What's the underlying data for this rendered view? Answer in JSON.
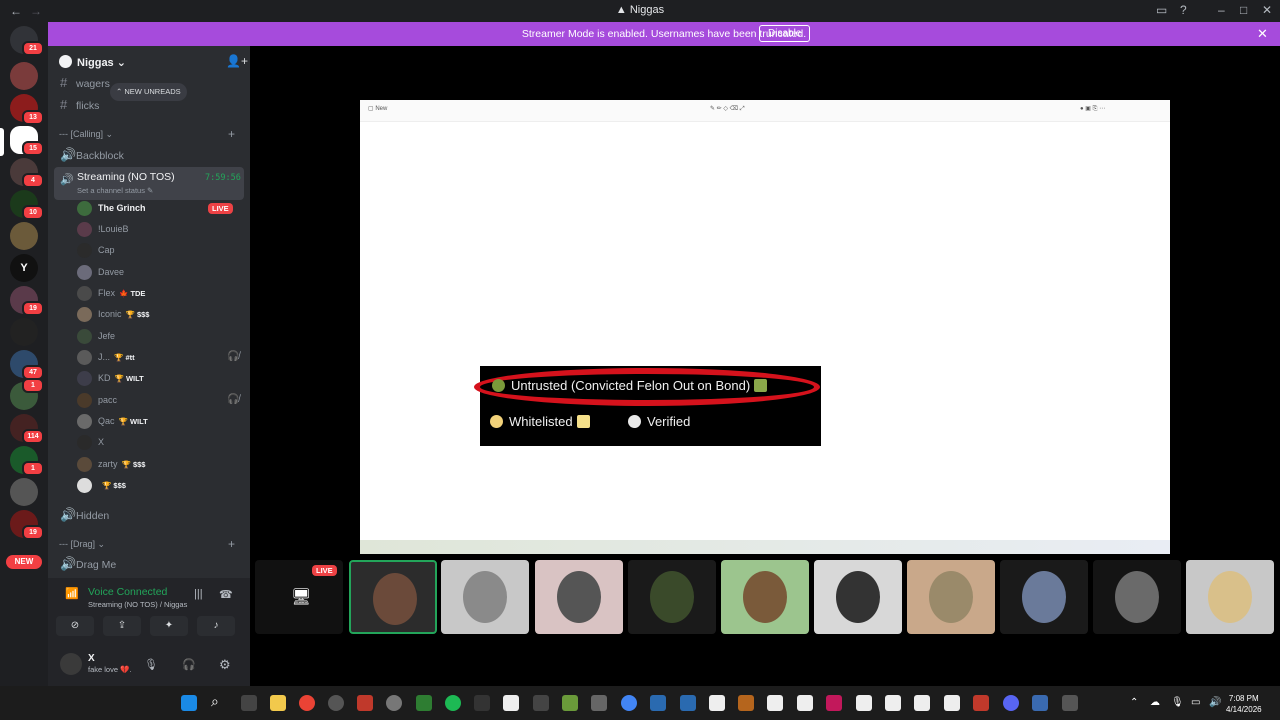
{
  "window": {
    "title": "Niggas"
  },
  "banner": {
    "message": "Streamer Mode is enabled. Usernames have been truncated.",
    "disable_label": "Disable"
  },
  "guild": {
    "name": "Niggas",
    "chevron": "⌄"
  },
  "channels": {
    "wagers": "wagers",
    "flicks": "flicks",
    "new_unreads": "NEW UNREADS",
    "cat_calling": "--- [Calling]",
    "backblock": "Backblock",
    "streaming": "Streaming (NO TOS)",
    "streaming_status": "Set a channel status",
    "streaming_timer": "7:59:56",
    "hidden": "Hidden",
    "cat_drag": "--- [Drag]",
    "drag_me": "Drag Me"
  },
  "voice_users": [
    {
      "name": "The Grinch",
      "tag": "",
      "live": "LIVE"
    },
    {
      "name": "!LouieB",
      "tag": ""
    },
    {
      "name": "Cap",
      "tag": ""
    },
    {
      "name": "Davee",
      "tag": ""
    },
    {
      "name": "Flex",
      "tag": "🍁 TDE"
    },
    {
      "name": "Iconic",
      "tag": "🏆 $$$"
    },
    {
      "name": "Jefe",
      "tag": ""
    },
    {
      "name": "J...",
      "tag": "🏆 #tt"
    },
    {
      "name": "KD",
      "tag": "🏆 WILT"
    },
    {
      "name": "pacc",
      "tag": ""
    },
    {
      "name": "Qac",
      "tag": "🏆 WILT"
    },
    {
      "name": "X",
      "tag": ""
    },
    {
      "name": "zarty",
      "tag": "🏆 $$$"
    },
    {
      "name": "",
      "tag": "🏆 $$$"
    }
  ],
  "panel": {
    "voice_connected": "Voice Connected",
    "voice_location": "Streaming (NO TOS) / Niggas",
    "me_name": "X",
    "me_status": "fake love 💔."
  },
  "stream": {
    "badge_untrusted": "Untrusted (Convicted Felon Out on Bond)",
    "badge_whitelisted": "Whitelisted",
    "badge_verified": "Verified",
    "tile_live": "LIVE"
  },
  "server_badges": [
    "21",
    "13",
    "15",
    "4",
    "10",
    "19",
    "47",
    "1",
    "114",
    "1",
    "19"
  ],
  "server_letter": "Y",
  "new_label": "NEW",
  "clock": {
    "time": "7:08 PM",
    "date": "4/14/2026"
  },
  "colors": {
    "accent": "#a64bdc",
    "live": "#ed4245",
    "online": "#23a55a"
  }
}
